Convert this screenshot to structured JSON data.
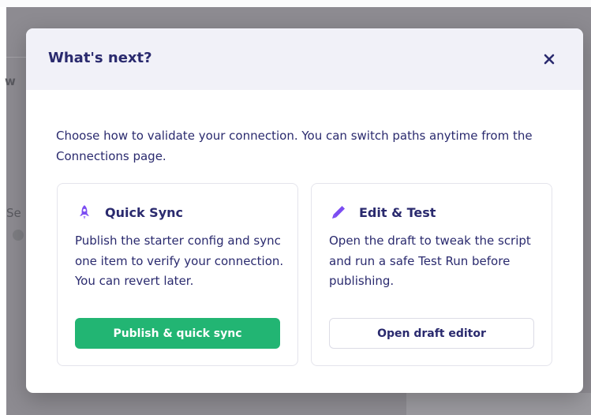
{
  "modal": {
    "title": "What's next?",
    "close_icon": "close-icon",
    "intro": "Choose how to validate your connection. You can switch paths anytime from the Connections page.",
    "options": [
      {
        "icon": "rocket-icon",
        "title": "Quick Sync",
        "description": "Publish the starter config and sync one item to verify your connection. You can revert later.",
        "button_label": "Publish & quick sync"
      },
      {
        "icon": "pencil-icon",
        "title": "Edit & Test",
        "description": "Open the draft to tweak the script and run a safe Test Run before publishing.",
        "button_label": "Open draft editor"
      }
    ]
  },
  "background": {
    "heading_fragment": "w",
    "label_fragment": "Se"
  },
  "colors": {
    "primary_text": "#2a2a6e",
    "accent_green": "#22b573",
    "icon_purple": "#7b4cf2",
    "header_bg": "#f1f1f8",
    "backdrop": "#8d8b91"
  }
}
